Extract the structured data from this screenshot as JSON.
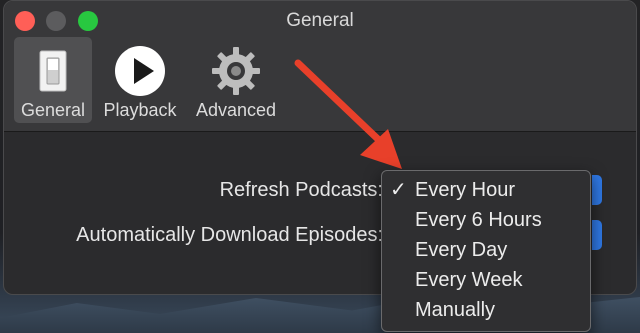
{
  "window": {
    "title": "General"
  },
  "toolbar": {
    "items": [
      {
        "label": "General",
        "icon": "switch-icon",
        "selected": true
      },
      {
        "label": "Playback",
        "icon": "play-icon",
        "selected": false
      },
      {
        "label": "Advanced",
        "icon": "gear-icon",
        "selected": false
      }
    ]
  },
  "settings": {
    "refresh_label": "Refresh Podcasts:",
    "download_label": "Automatically Download Episodes:"
  },
  "refresh_menu": {
    "selected": "Every Hour",
    "options": [
      "Every Hour",
      "Every 6 Hours",
      "Every Day",
      "Every Week",
      "Manually"
    ],
    "checkmark": "✓"
  },
  "colors": {
    "accent": "#2f78e4",
    "annotation_arrow": "#e8402a",
    "close": "#ff5f57",
    "zoom": "#28c840"
  }
}
